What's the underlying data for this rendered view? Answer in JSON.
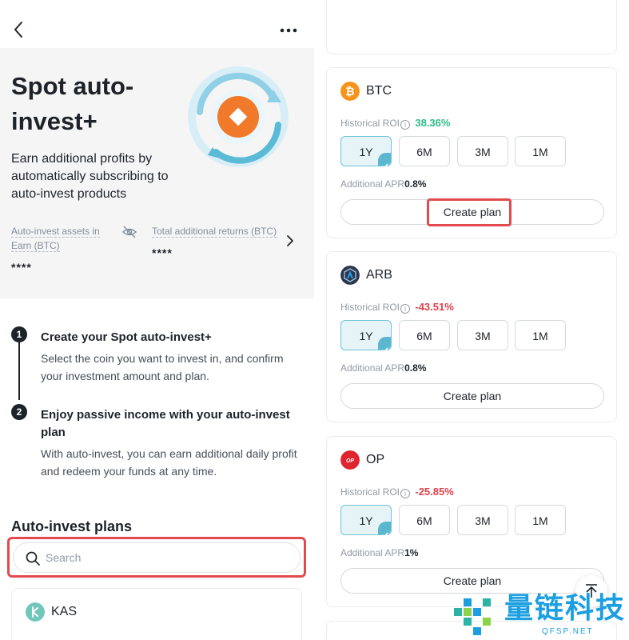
{
  "left": {
    "hero": {
      "title": "Spot auto-invest+",
      "description": "Earn additional profits by automatically subscribing to auto-invest products",
      "stat1_label": "Auto-invest assets in Earn (BTC)",
      "stat1_value": "****",
      "stat2_label": "Total additional returns (BTC)",
      "stat2_value": "****"
    },
    "steps": [
      {
        "num": "1",
        "title": "Create your Spot auto-invest+",
        "desc": "Select the coin you want to invest in, and confirm your investment amount and plan."
      },
      {
        "num": "2",
        "title": "Enjoy passive income with your auto-invest plan",
        "desc": "With auto-invest, you can earn additional daily profit and redeem your funds at any time."
      }
    ],
    "plans_title": "Auto-invest plans",
    "search_placeholder": "Search",
    "first_coin": "KAS"
  },
  "right": {
    "cards": [
      {
        "coin": "BTC",
        "roi_label": "Historical ROI",
        "roi": "38.36%",
        "apr_label": "Additional APR",
        "apr": "0.8%",
        "button": "Create plan",
        "periods": [
          "1Y",
          "6M",
          "3M",
          "1M"
        ]
      },
      {
        "coin": "ARB",
        "roi_label": "Historical ROI",
        "roi": "-43.51%",
        "apr_label": "Additional APR",
        "apr": "0.8%",
        "button": "Create plan",
        "periods": [
          "1Y",
          "6M",
          "3M",
          "1M"
        ]
      },
      {
        "coin": "OP",
        "roi_label": "Historical ROI",
        "roi": "-25.85%",
        "apr_label": "Additional APR",
        "apr": "1%",
        "button": "Create plan",
        "periods": [
          "1Y",
          "6M",
          "3M",
          "1M"
        ]
      }
    ],
    "op_icon_text": "OP"
  },
  "colors": {
    "positive": "#2ebd85",
    "negative": "#e0404a",
    "highlight": "#e24a4e",
    "accent": "#5bb7cf"
  },
  "watermark": {
    "text": "量链科技",
    "sub": "QFSP.NET"
  }
}
